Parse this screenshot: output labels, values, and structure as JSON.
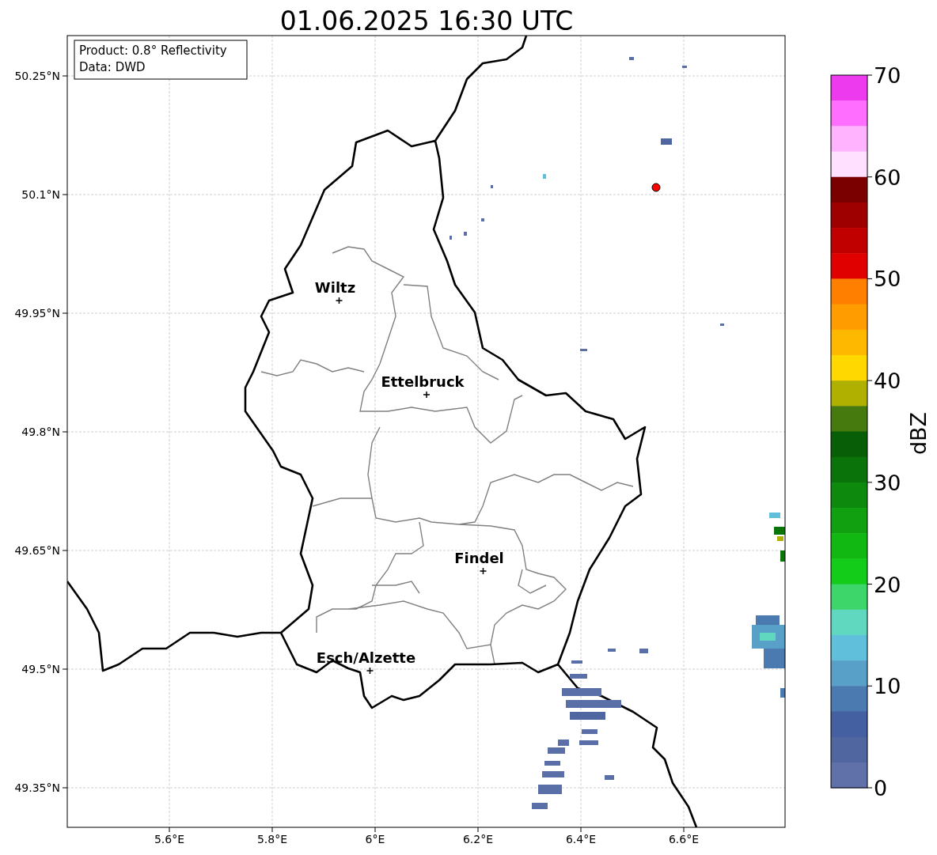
{
  "title": "01.06.2025 16:30 UTC",
  "info_box": {
    "lines": [
      "Product: 0.8° Reflectivity",
      "Data: DWD"
    ]
  },
  "map": {
    "lat_labels": [
      "50.25°N",
      "50.1°N",
      "49.95°N",
      "49.8°N",
      "49.65°N",
      "49.5°N",
      "49.35°N"
    ],
    "lon_labels": [
      "5.6°E",
      "5.8°E",
      "6°E",
      "6.2°E",
      "6.4°E",
      "6.6°E"
    ],
    "cities": [
      {
        "name": "Wiltz"
      },
      {
        "name": "Ettelbruck"
      },
      {
        "name": "Findel"
      },
      {
        "name": "Esch/Alzette"
      }
    ]
  },
  "colorbar": {
    "label": "dBZ",
    "ticks": [
      "70",
      "60",
      "50",
      "40",
      "30",
      "20",
      "10",
      "0"
    ],
    "segments": [
      {
        "color": "#ee3aee"
      },
      {
        "color": "#ff6eff"
      },
      {
        "color": "#ffb3ff"
      },
      {
        "color": "#ffe0ff"
      },
      {
        "color": "#7a0000"
      },
      {
        "color": "#9e0000"
      },
      {
        "color": "#c00000"
      },
      {
        "color": "#e00000"
      },
      {
        "color": "#ff8000"
      },
      {
        "color": "#ff9c00"
      },
      {
        "color": "#ffb800"
      },
      {
        "color": "#ffd800"
      },
      {
        "color": "#b0b000"
      },
      {
        "color": "#467a0f"
      },
      {
        "color": "#075e07"
      },
      {
        "color": "#0a730a"
      },
      {
        "color": "#0d8a0d"
      },
      {
        "color": "#10a010"
      },
      {
        "color": "#12b812"
      },
      {
        "color": "#13cc19"
      },
      {
        "color": "#3dd66a"
      },
      {
        "color": "#60d8c0"
      },
      {
        "color": "#60c0dc"
      },
      {
        "color": "#58a0c8"
      },
      {
        "color": "#4a7ab0"
      },
      {
        "color": "#4460a0"
      },
      {
        "color": "#5066a0"
      },
      {
        "color": "#6070a8"
      }
    ]
  }
}
